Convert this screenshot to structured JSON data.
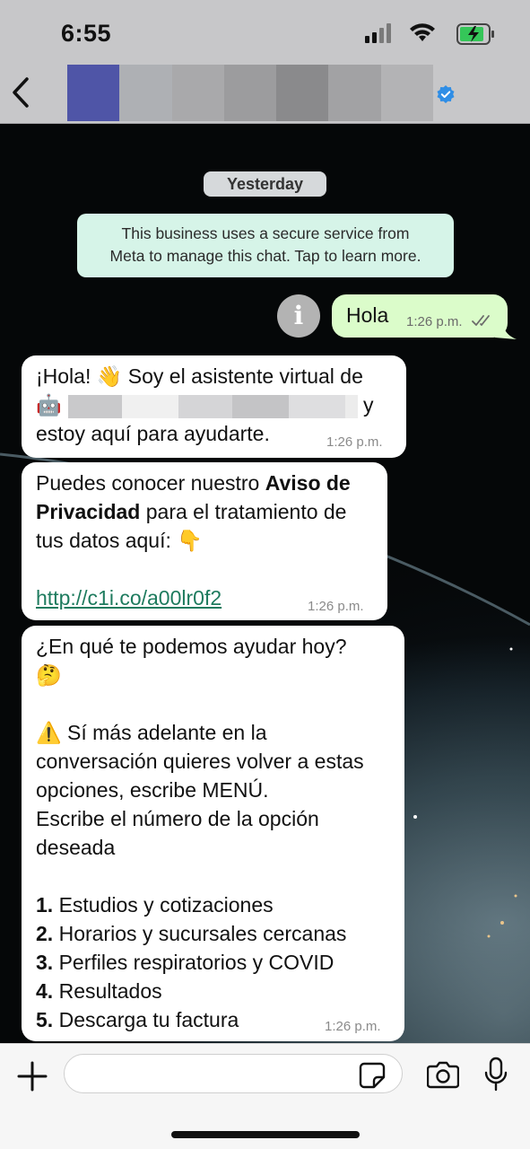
{
  "status_bar": {
    "time": "6:55"
  },
  "header": {
    "back_icon": "chevron-left-icon",
    "verified_icon": "verified-badge-icon",
    "contact_mosaic_colors": [
      "#4f55a7",
      "#aeb0b4",
      "#a9a9ab",
      "#9c9c9e",
      "#8a8a8c",
      "#a2a2a4",
      "#b3b3b5"
    ]
  },
  "chat": {
    "date_label": "Yesterday",
    "business_notice": {
      "line1": "This business uses a secure service from",
      "line2": "Meta to manage this chat. Tap to learn more."
    },
    "outgoing": {
      "text": "Hola",
      "time": "1:26 p.m.",
      "status_icon": "double-check-icon"
    },
    "messages": [
      {
        "line1_a": "¡Hola! ",
        "line1_emoji": "👋",
        "line1_b": " Soy el asistente virtual de",
        "line2_emoji": "🤖",
        "line2_tail": "y",
        "line3": "estoy aquí para ayudarte.",
        "time": "1:26 p.m."
      },
      {
        "line1_a": "Puedes conocer nuestro ",
        "line1_bold": "Aviso de",
        "line2_bold": "Privacidad",
        "line2_b": " para el tratamiento de",
        "line3_a": "tus datos aquí: ",
        "line3_emoji": "👇",
        "link": "http://c1i.co/a00lr0f2",
        "time": "1:26 p.m."
      },
      {
        "line1": "¿En qué te podemos ayudar hoy?",
        "line2_emoji": "🤔",
        "warn_emoji": "⚠️",
        "line3": " Sí más adelante en la",
        "line4": "conversación quieres volver a estas",
        "line5": "opciones, escribe MENÚ.",
        "line6": "Escribe el número de la opción",
        "line7": "deseada",
        "options": [
          {
            "num": "1.",
            "text": " Estudios y cotizaciones"
          },
          {
            "num": "2.",
            "text": " Horarios y sucursales cercanas"
          },
          {
            "num": "3.",
            "text": " Perfiles respiratorios y COVID"
          },
          {
            "num": "4.",
            "text": " Resultados"
          },
          {
            "num": "5.",
            "text": " Descarga tu factura"
          }
        ],
        "time": "1:26 p.m."
      }
    ]
  },
  "composer": {
    "placeholder": "",
    "plus_icon": "plus-icon",
    "sticker_icon": "sticker-icon",
    "camera_icon": "camera-icon",
    "mic_icon": "microphone-icon"
  }
}
